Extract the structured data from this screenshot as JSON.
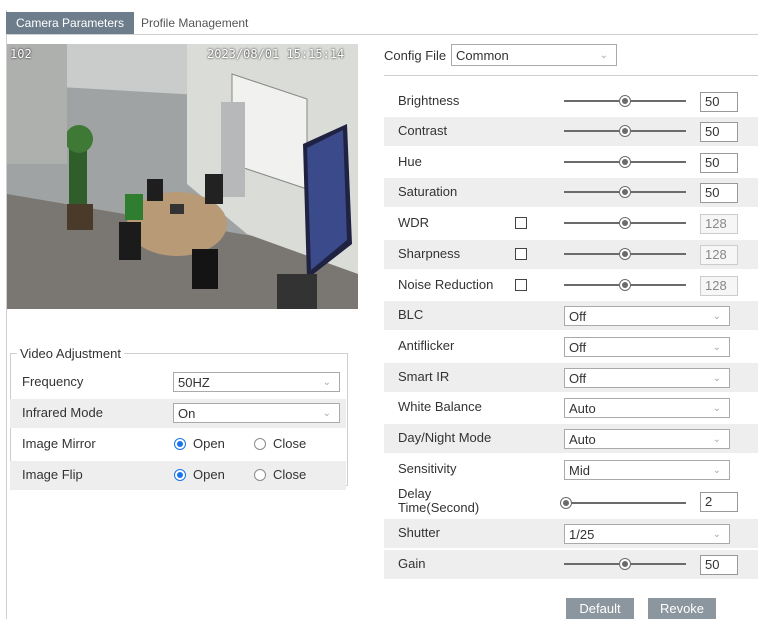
{
  "tabs": [
    "Camera Parameters",
    "Profile Management"
  ],
  "preview": {
    "channel": "102",
    "timestamp": "2023/08/01 15:15:14"
  },
  "video_adjustment": {
    "title": "Video Adjustment",
    "rows": [
      {
        "label": "Frequency",
        "type": "select",
        "value": "50HZ"
      },
      {
        "label": "Infrared Mode",
        "type": "select",
        "value": "On"
      },
      {
        "label": "Image Mirror",
        "type": "radio",
        "options": [
          "Open",
          "Close"
        ],
        "selected": "Open"
      },
      {
        "label": "Image Flip",
        "type": "radio",
        "options": [
          "Open",
          "Close"
        ],
        "selected": "Open"
      }
    ]
  },
  "config_file": {
    "label": "Config File",
    "value": "Common"
  },
  "params": [
    {
      "label": "Brightness",
      "type": "slider",
      "value": "50",
      "level": 0.5
    },
    {
      "label": "Contrast",
      "type": "slider",
      "value": "50",
      "level": 0.5
    },
    {
      "label": "Hue",
      "type": "slider",
      "value": "50",
      "level": 0.5
    },
    {
      "label": "Saturation",
      "type": "slider",
      "value": "50",
      "level": 0.5
    },
    {
      "label": "WDR",
      "type": "check-slider",
      "value": "128",
      "level": 0.5,
      "checked": false
    },
    {
      "label": "Sharpness",
      "type": "check-slider",
      "value": "128",
      "level": 0.5,
      "checked": false
    },
    {
      "label": "Noise Reduction",
      "type": "check-slider",
      "value": "128",
      "level": 0.5,
      "checked": false
    },
    {
      "label": "BLC",
      "type": "select",
      "value": "Off"
    },
    {
      "label": "Antiflicker",
      "type": "select",
      "value": "Off"
    },
    {
      "label": "Smart IR",
      "type": "select",
      "value": "Off"
    },
    {
      "label": "White Balance",
      "type": "select",
      "value": "Auto"
    },
    {
      "label": "Day/Night Mode",
      "type": "select",
      "value": "Auto"
    },
    {
      "label": "Sensitivity",
      "type": "select",
      "value": "Mid"
    },
    {
      "label": "Delay Time(Second)",
      "type": "slider",
      "value": "2",
      "level": 0.02
    },
    {
      "label": "Shutter",
      "type": "select",
      "value": "1/25"
    },
    {
      "label": "Gain",
      "type": "slider",
      "value": "50",
      "level": 0.5
    }
  ],
  "buttons": {
    "default": "Default",
    "revoke": "Revoke"
  },
  "colors": {
    "tab_active": "#6d7d8b",
    "radio_selected": "#1a73e8",
    "button": "#8c969e",
    "row_shade": "#eeeeee"
  }
}
